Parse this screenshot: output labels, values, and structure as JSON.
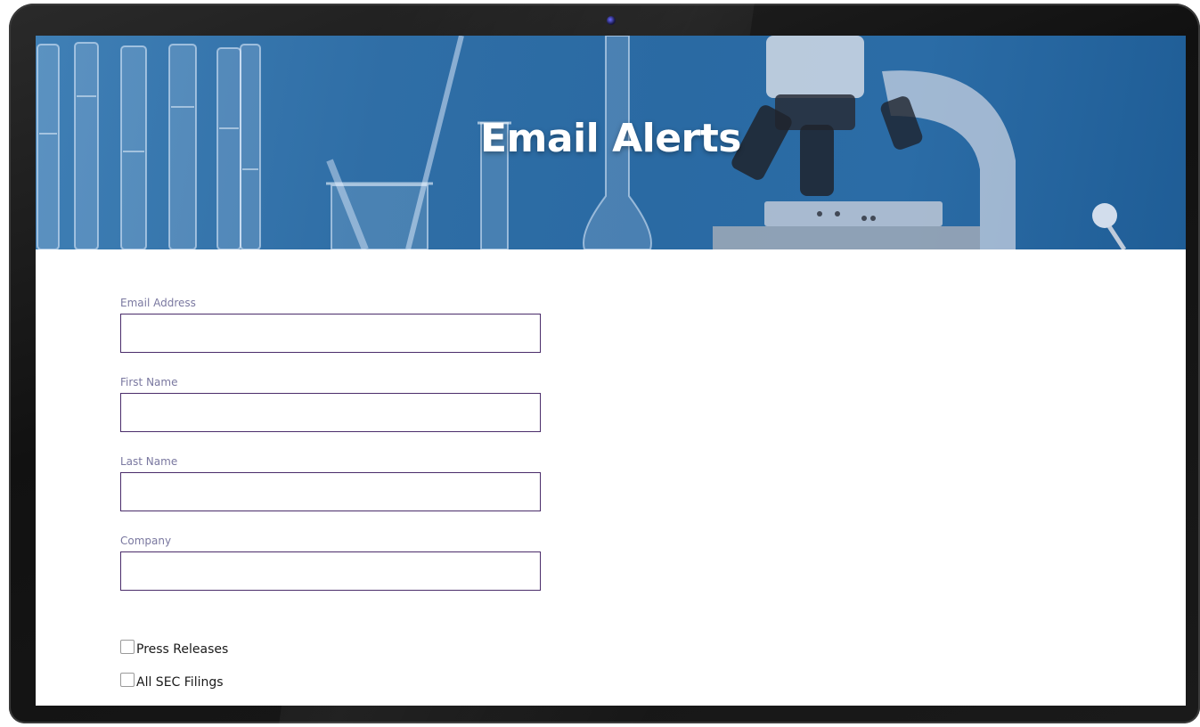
{
  "page": {
    "title": "Email Alerts"
  },
  "form": {
    "email": {
      "label": "Email Address",
      "value": "",
      "placeholder": ""
    },
    "first_name": {
      "label": "First Name",
      "value": "",
      "placeholder": ""
    },
    "last_name": {
      "label": "Last Name",
      "value": "",
      "placeholder": ""
    },
    "company": {
      "label": "Company",
      "value": "",
      "placeholder": ""
    }
  },
  "subscriptions": [
    {
      "label": "Press Releases",
      "checked": false
    },
    {
      "label": "All SEC Filings",
      "checked": false
    }
  ],
  "colors": {
    "input_border": "#4a2c6a",
    "label_text": "#7a78a0",
    "hero_blue": "#2a6aa3"
  },
  "icons": {
    "device_camera": "camera-icon"
  }
}
